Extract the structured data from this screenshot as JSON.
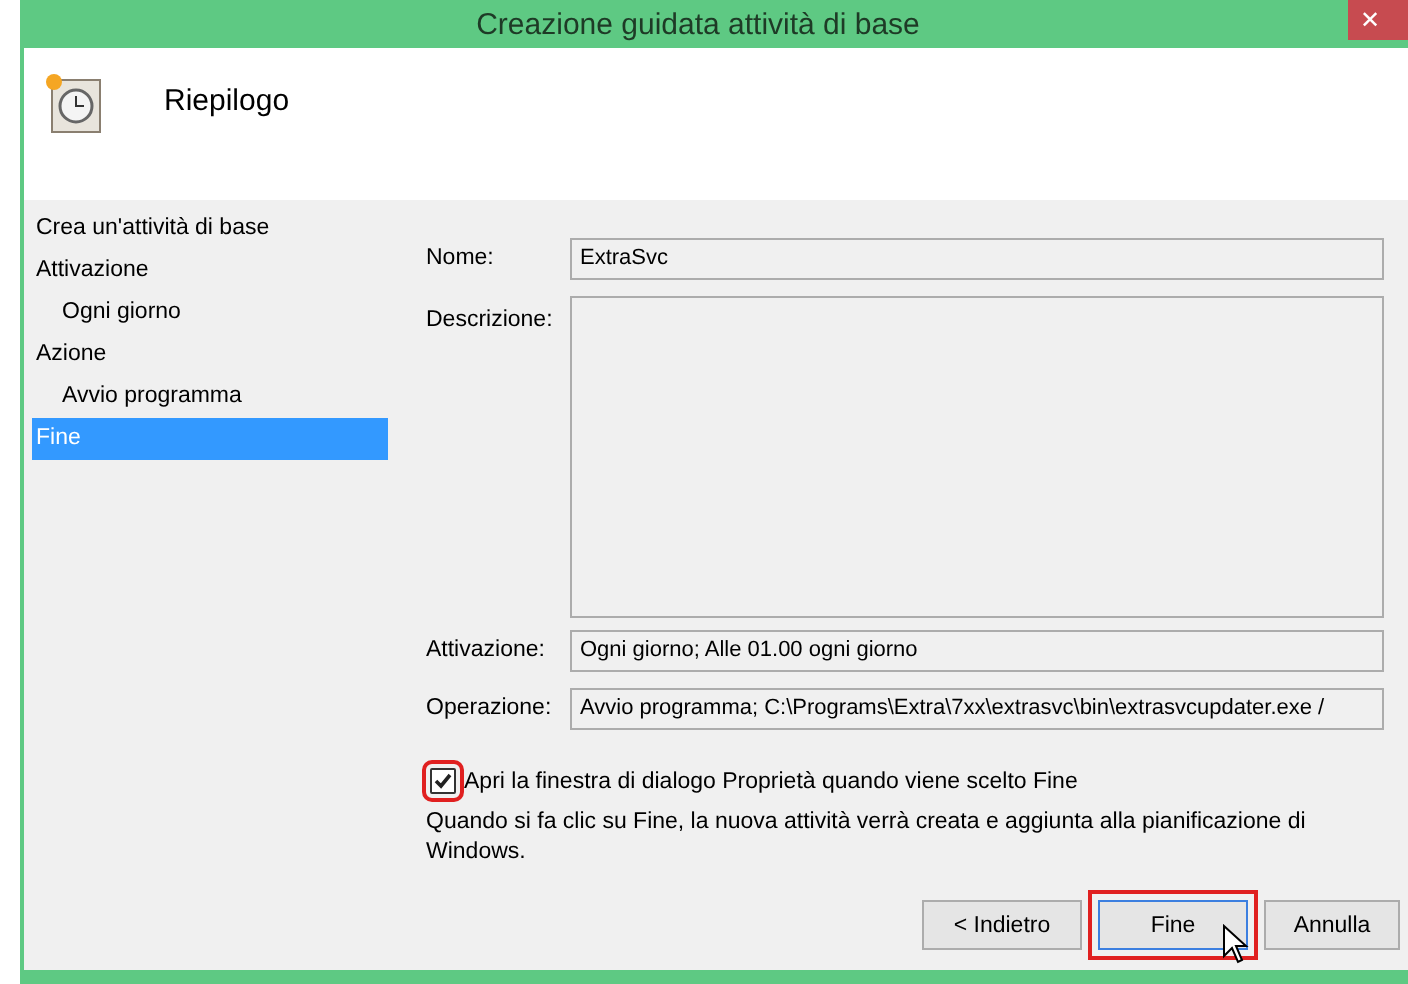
{
  "window": {
    "title": "Creazione guidata attività di base",
    "close": "✕"
  },
  "header": {
    "title": "Riepilogo"
  },
  "sidebar": {
    "items": [
      {
        "label": "Crea un'attività di base",
        "selected": false
      },
      {
        "label": "Attivazione",
        "selected": false,
        "children": [
          {
            "label": "Ogni giorno",
            "selected": false
          }
        ]
      },
      {
        "label": "Azione",
        "selected": false,
        "children": [
          {
            "label": "Avvio programma",
            "selected": false
          }
        ]
      },
      {
        "label": "Fine",
        "selected": true
      }
    ]
  },
  "fields": [
    {
      "kind": "line",
      "label": "Nome:",
      "value": "ExtraSvc"
    },
    {
      "kind": "area",
      "label": "Descrizione:"
    },
    {
      "kind": "line",
      "label": "Attivazione:",
      "value": "Ogni giorno; Alle 01.00 ogni giorno"
    },
    {
      "kind": "line",
      "label": "Operazione:",
      "value": "Avvio programma; C:\\Programs\\Extra\\7xx\\extrasvc\\bin\\extrasvcupdater.exe /"
    }
  ],
  "checkbox": {
    "label": "Apri la finestra di dialogo Proprietà quando viene scelto Fine",
    "checked": true,
    "highlighted": true
  },
  "note": "Quando si fa clic su Fine, la nuova attività verrà creata e aggiunta alla pianificazione di Windows.",
  "buttons": [
    {
      "label": "< Indietro",
      "focused": false,
      "highlighted": false
    },
    {
      "label": "Fine",
      "focused": true,
      "highlighted": true
    },
    {
      "label": "Annulla",
      "focused": false,
      "highlighted": false
    }
  ]
}
